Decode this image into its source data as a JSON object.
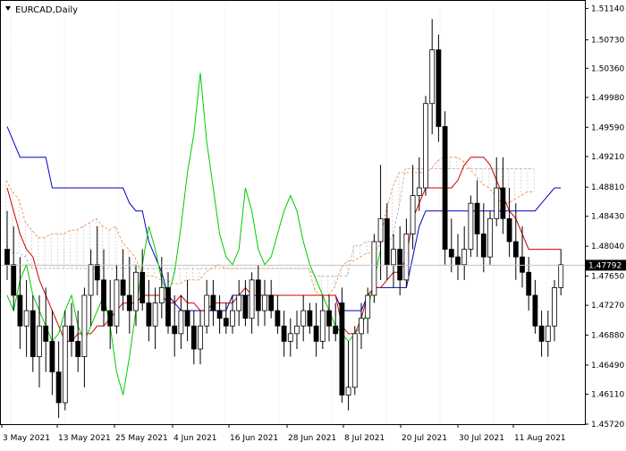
{
  "window": {
    "symbol_label": "EURCAD,Daily",
    "current_price_label": "1.47792"
  },
  "chart_data": {
    "type": "candlestick",
    "symbol": "EURCAD",
    "timeframe": "Daily",
    "ylim": [
      1.4572,
      1.5125
    ],
    "y_ticks": [
      "1.51140",
      "1.50730",
      "1.50360",
      "1.49980",
      "1.49590",
      "1.49210",
      "1.48810",
      "1.48430",
      "1.48040",
      "1.47650",
      "1.47270",
      "1.46880",
      "1.46490",
      "1.46110",
      "1.45720"
    ],
    "x_ticks": [
      "3 May 2021",
      "13 May 2021",
      "25 May 2021",
      "4 Jun 2021",
      "16 Jun 2021",
      "28 Jun 2021",
      "8 Jul 2021",
      "20 Jul 2021",
      "30 Jul 2021",
      "11 Aug 2021"
    ],
    "current_price": 1.47792,
    "colors": {
      "bull": "#ffffff",
      "bear": "#000000",
      "kijun": "#0000cc",
      "tenkan": "#cc0000",
      "chikou": "#00cc00",
      "senkou_b": "#aaaaaa",
      "senkou_a": "#ee8844",
      "price_tag": "#000000"
    },
    "candles": [
      [
        1.48,
        1.485,
        1.476,
        1.478
      ],
      [
        1.478,
        1.483,
        1.472,
        1.474
      ],
      [
        1.474,
        1.479,
        1.467,
        1.47
      ],
      [
        1.47,
        1.476,
        1.466,
        1.472
      ],
      [
        1.472,
        1.474,
        1.464,
        1.466
      ],
      [
        1.466,
        1.474,
        1.462,
        1.47
      ],
      [
        1.47,
        1.475,
        1.464,
        1.468
      ],
      [
        1.468,
        1.472,
        1.461,
        1.464
      ],
      [
        1.464,
        1.468,
        1.458,
        1.46
      ],
      [
        1.46,
        1.472,
        1.459,
        1.47
      ],
      [
        1.47,
        1.473,
        1.466,
        1.468
      ],
      [
        1.468,
        1.472,
        1.464,
        1.466
      ],
      [
        1.466,
        1.475,
        1.462,
        1.474
      ],
      [
        1.474,
        1.48,
        1.47,
        1.478
      ],
      [
        1.478,
        1.483,
        1.474,
        1.476
      ],
      [
        1.476,
        1.48,
        1.47,
        1.472
      ],
      [
        1.472,
        1.476,
        1.467,
        1.47
      ],
      [
        1.47,
        1.478,
        1.469,
        1.476
      ],
      [
        1.476,
        1.48,
        1.472,
        1.474
      ],
      [
        1.474,
        1.479,
        1.469,
        1.472
      ],
      [
        1.472,
        1.478,
        1.47,
        1.477
      ],
      [
        1.477,
        1.48,
        1.472,
        1.473
      ],
      [
        1.473,
        1.476,
        1.468,
        1.47
      ],
      [
        1.47,
        1.475,
        1.467,
        1.473
      ],
      [
        1.473,
        1.479,
        1.471,
        1.475
      ],
      [
        1.475,
        1.477,
        1.469,
        1.47
      ],
      [
        1.47,
        1.474,
        1.466,
        1.469
      ],
      [
        1.469,
        1.474,
        1.467,
        1.472
      ],
      [
        1.472,
        1.476,
        1.468,
        1.47
      ],
      [
        1.47,
        1.472,
        1.465,
        1.467
      ],
      [
        1.467,
        1.472,
        1.465,
        1.47
      ],
      [
        1.47,
        1.476,
        1.469,
        1.474
      ],
      [
        1.474,
        1.476,
        1.47,
        1.472
      ],
      [
        1.472,
        1.474,
        1.469,
        1.471
      ],
      [
        1.471,
        1.473,
        1.469,
        1.47
      ],
      [
        1.47,
        1.474,
        1.469,
        1.472
      ],
      [
        1.472,
        1.476,
        1.47,
        1.474
      ],
      [
        1.474,
        1.476,
        1.47,
        1.471
      ],
      [
        1.471,
        1.477,
        1.469,
        1.476
      ],
      [
        1.476,
        1.478,
        1.47,
        1.472
      ],
      [
        1.472,
        1.476,
        1.47,
        1.474
      ],
      [
        1.474,
        1.476,
        1.471,
        1.472
      ],
      [
        1.472,
        1.474,
        1.469,
        1.47
      ],
      [
        1.47,
        1.472,
        1.466,
        1.468
      ],
      [
        1.468,
        1.471,
        1.466,
        1.469
      ],
      [
        1.469,
        1.472,
        1.467,
        1.47
      ],
      [
        1.47,
        1.474,
        1.468,
        1.472
      ],
      [
        1.472,
        1.473,
        1.469,
        1.47
      ],
      [
        1.47,
        1.473,
        1.466,
        1.468
      ],
      [
        1.468,
        1.474,
        1.467,
        1.472
      ],
      [
        1.472,
        1.474,
        1.468,
        1.47
      ],
      [
        1.47,
        1.473,
        1.468,
        1.469
      ],
      [
        1.473,
        1.475,
        1.46,
        1.461
      ],
      [
        1.461,
        1.468,
        1.459,
        1.462
      ],
      [
        1.462,
        1.47,
        1.461,
        1.469
      ],
      [
        1.469,
        1.473,
        1.467,
        1.471
      ],
      [
        1.471,
        1.475,
        1.469,
        1.474
      ],
      [
        1.474,
        1.482,
        1.473,
        1.481
      ],
      [
        1.481,
        1.491,
        1.476,
        1.484
      ],
      [
        1.484,
        1.486,
        1.476,
        1.478
      ],
      [
        1.478,
        1.482,
        1.475,
        1.48
      ],
      [
        1.48,
        1.483,
        1.474,
        1.476
      ],
      [
        1.476,
        1.484,
        1.475,
        1.482
      ],
      [
        1.482,
        1.491,
        1.48,
        1.487
      ],
      [
        1.487,
        1.492,
        1.485,
        1.488
      ],
      [
        1.488,
        1.5,
        1.487,
        1.499
      ],
      [
        1.499,
        1.51,
        1.495,
        1.506
      ],
      [
        1.506,
        1.508,
        1.494,
        1.496
      ],
      [
        1.496,
        1.498,
        1.478,
        1.48
      ],
      [
        1.48,
        1.484,
        1.477,
        1.479
      ],
      [
        1.479,
        1.482,
        1.476,
        1.478
      ],
      [
        1.478,
        1.483,
        1.476,
        1.48
      ],
      [
        1.48,
        1.487,
        1.479,
        1.486
      ],
      [
        1.486,
        1.489,
        1.479,
        1.482
      ],
      [
        1.482,
        1.486,
        1.477,
        1.479
      ],
      [
        1.479,
        1.485,
        1.478,
        1.484
      ],
      [
        1.484,
        1.492,
        1.483,
        1.488
      ],
      [
        1.488,
        1.492,
        1.482,
        1.484
      ],
      [
        1.484,
        1.488,
        1.479,
        1.481
      ],
      [
        1.481,
        1.486,
        1.476,
        1.479
      ],
      [
        1.479,
        1.483,
        1.475,
        1.477
      ],
      [
        1.477,
        1.479,
        1.472,
        1.474
      ],
      [
        1.474,
        1.476,
        1.469,
        1.47
      ],
      [
        1.47,
        1.472,
        1.466,
        1.468
      ],
      [
        1.468,
        1.472,
        1.466,
        1.47
      ],
      [
        1.47,
        1.476,
        1.468,
        1.475
      ],
      [
        1.475,
        1.48,
        1.474,
        1.478
      ]
    ],
    "kijun": [
      1.496,
      1.494,
      1.492,
      1.492,
      1.492,
      1.492,
      1.492,
      1.488,
      1.488,
      1.488,
      1.488,
      1.488,
      1.488,
      1.488,
      1.488,
      1.488,
      1.488,
      1.488,
      1.488,
      1.486,
      1.485,
      1.485,
      1.481,
      1.479,
      1.477,
      1.474,
      1.473,
      1.472,
      1.472,
      1.472,
      1.472,
      1.472,
      1.472,
      1.472,
      1.472,
      1.474,
      1.474,
      1.474,
      1.474,
      1.474,
      1.474,
      1.474,
      1.474,
      1.474,
      1.474,
      1.474,
      1.474,
      1.474,
      1.474,
      1.474,
      1.474,
      1.474,
      1.472,
      1.472,
      1.472,
      1.472,
      1.474,
      1.475,
      1.475,
      1.475,
      1.475,
      1.475,
      1.475,
      1.479,
      1.483,
      1.485,
      1.485,
      1.485,
      1.485,
      1.485,
      1.485,
      1.485,
      1.485,
      1.485,
      1.485,
      1.485,
      1.485,
      1.485,
      1.485,
      1.485,
      1.485,
      1.485,
      1.485,
      1.486,
      1.487,
      1.488,
      1.488
    ],
    "tenkan": [
      1.488,
      1.485,
      1.482,
      1.48,
      1.479,
      1.476,
      1.474,
      1.472,
      1.47,
      1.468,
      1.468,
      1.469,
      1.469,
      1.469,
      1.47,
      1.47,
      1.471,
      1.472,
      1.473,
      1.473,
      1.473,
      1.474,
      1.474,
      1.474,
      1.474,
      1.473,
      1.473,
      1.474,
      1.473,
      1.473,
      1.472,
      1.472,
      1.473,
      1.473,
      1.473,
      1.473,
      1.474,
      1.475,
      1.474,
      1.474,
      1.474,
      1.474,
      1.474,
      1.474,
      1.474,
      1.474,
      1.474,
      1.474,
      1.474,
      1.474,
      1.474,
      1.474,
      1.47,
      1.469,
      1.469,
      1.471,
      1.474,
      1.475,
      1.475,
      1.476,
      1.477,
      1.477,
      1.479,
      1.484,
      1.486,
      1.488,
      1.488,
      1.488,
      1.488,
      1.488,
      1.489,
      1.491,
      1.492,
      1.492,
      1.492,
      1.491,
      1.489,
      1.487,
      1.485,
      1.484,
      1.482,
      1.48,
      1.48,
      1.48,
      1.48,
      1.48,
      1.48
    ],
    "chikou": [
      1.474,
      1.472,
      1.476,
      1.478,
      1.474,
      1.472,
      1.47,
      1.468,
      1.469,
      1.472,
      1.474,
      1.47,
      1.468,
      1.47,
      1.472,
      1.474,
      1.47,
      1.464,
      1.461,
      1.466,
      1.472,
      1.478,
      1.483,
      1.48,
      1.476,
      1.474,
      1.477,
      1.483,
      1.49,
      1.495,
      1.503,
      1.494,
      1.488,
      1.482,
      1.479,
      1.478,
      1.48,
      1.488,
      1.485,
      1.48,
      1.478,
      1.479,
      1.482,
      1.485,
      1.487,
      1.485,
      1.481,
      1.478,
      1.476,
      1.474,
      1.472,
      1.47,
      1.469,
      1.468,
      1.469,
      1.47,
      1.472,
      1.476,
      1.48
    ]
  }
}
